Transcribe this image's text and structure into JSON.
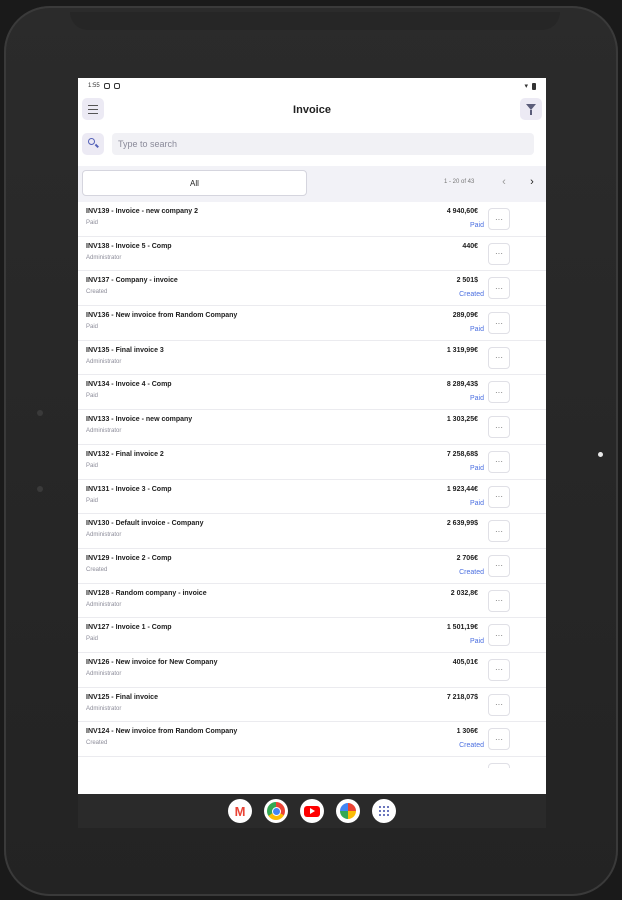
{
  "status_bar": {
    "time": "1:55"
  },
  "header": {
    "title": "Invoice"
  },
  "search": {
    "placeholder": "Type to search",
    "value": ""
  },
  "tabs": {
    "all_label": "All"
  },
  "pagination": {
    "summary": "1 - 20 of 43",
    "prev": "‹",
    "next": "›"
  },
  "colors": {
    "accent": "#4b6fe0",
    "screen_bg": "#ffffff",
    "tabs_bg": "#f2f2f7"
  },
  "more_label": "···",
  "invoices": [
    {
      "title": "INV139 - Invoice - new company 2",
      "subtitle": "Paid",
      "amount": "4 940,60€",
      "status": "Paid"
    },
    {
      "title": "INV138 - Invoice 5 - Comp",
      "subtitle": "Administrator",
      "amount": "440€",
      "status": ""
    },
    {
      "title": "INV137 - Company - invoice",
      "subtitle": "Created",
      "amount": "2 501$",
      "status": "Created"
    },
    {
      "title": "INV136 - New invoice from Random Company",
      "subtitle": "Paid",
      "amount": "289,09€",
      "status": "Paid"
    },
    {
      "title": "INV135 - Final invoice 3",
      "subtitle": "Administrator",
      "amount": "1 319,99€",
      "status": ""
    },
    {
      "title": "INV134 - Invoice 4 - Comp",
      "subtitle": "Paid",
      "amount": "8 289,43$",
      "status": "Paid"
    },
    {
      "title": "INV133 - Invoice - new company",
      "subtitle": "Administrator",
      "amount": "1 303,25€",
      "status": ""
    },
    {
      "title": "INV132 - Final invoice 2",
      "subtitle": "Paid",
      "amount": "7 258,68$",
      "status": "Paid"
    },
    {
      "title": "INV131 - Invoice 3 - Comp",
      "subtitle": "Paid",
      "amount": "1 923,44€",
      "status": "Paid"
    },
    {
      "title": "INV130 - Default invoice - Company",
      "subtitle": "Administrator",
      "amount": "2 639,99$",
      "status": ""
    },
    {
      "title": "INV129 - Invoice 2 - Comp",
      "subtitle": "Created",
      "amount": "2 706€",
      "status": "Created"
    },
    {
      "title": "INV128 - Random company - invoice",
      "subtitle": "Administrator",
      "amount": "2 032,8€",
      "status": ""
    },
    {
      "title": "INV127 - Invoice 1 - Comp",
      "subtitle": "Paid",
      "amount": "1 501,19€",
      "status": "Paid"
    },
    {
      "title": "INV126 - New invoice for New Company",
      "subtitle": "Administrator",
      "amount": "405,01€",
      "status": ""
    },
    {
      "title": "INV125 - Final invoice",
      "subtitle": "Administrator",
      "amount": "7 218,07$",
      "status": ""
    },
    {
      "title": "INV124 - New invoice from Random Company",
      "subtitle": "Created",
      "amount": "1 306€",
      "status": "Created"
    },
    {
      "title": "",
      "subtitle": "",
      "amount": "",
      "status": ""
    }
  ],
  "dock": {
    "apps": [
      {
        "name": "gmail-icon",
        "glyph": "M"
      },
      {
        "name": "chrome-icon",
        "glyph": ""
      },
      {
        "name": "youtube-icon",
        "glyph": ""
      },
      {
        "name": "photos-icon",
        "glyph": ""
      },
      {
        "name": "app-drawer-icon",
        "glyph": ""
      }
    ]
  }
}
